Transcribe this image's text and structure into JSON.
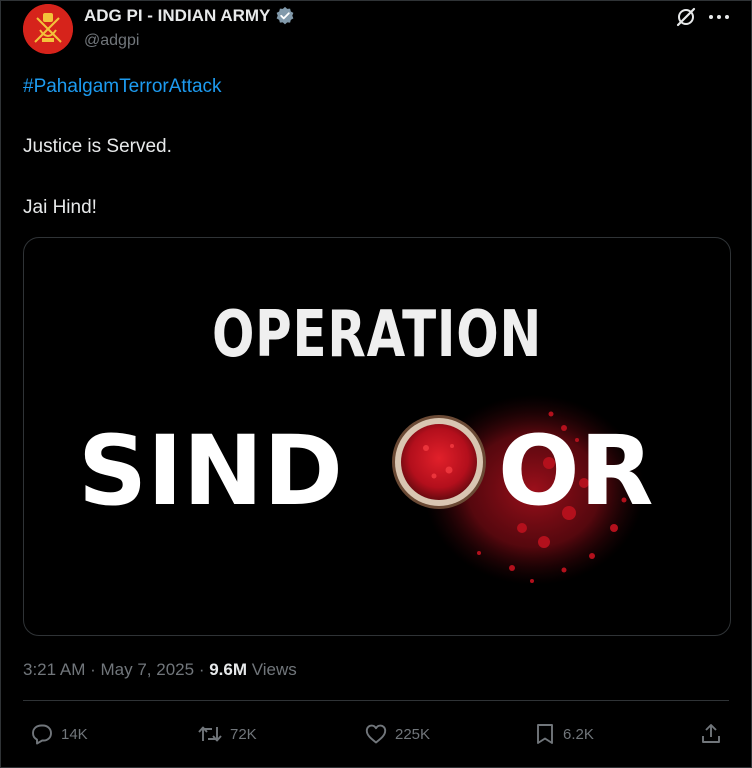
{
  "post": {
    "author_name": "ADG PI - INDIAN ARMY",
    "author_handle": "@adgpi",
    "hashtag": "#PahalgamTerrorAttack",
    "line_2": "Justice is Served.",
    "line_3": "Jai Hind!",
    "image": {
      "title_top": "OPERATION",
      "title_left": "SIND",
      "title_right": "OR"
    },
    "time": "3:21 AM",
    "separator": "·",
    "date": "May 7, 2025",
    "views_count": "9.6M",
    "views_label": "Views"
  },
  "actions": {
    "replies": "14K",
    "reposts": "72K",
    "likes": "225K",
    "bookmarks": "6.2K"
  },
  "colors": {
    "background": "#000000",
    "text": "#e7e9ea",
    "muted": "#71767b",
    "link": "#1d9bf0",
    "border": "#2f3336",
    "avatar": "#d6231b",
    "sindoor_red": "#c8102e"
  },
  "icons": [
    "verified-badge-icon",
    "grok-icon",
    "more-icon",
    "reply-icon",
    "repost-icon",
    "like-icon",
    "bookmark-icon",
    "share-icon"
  ]
}
